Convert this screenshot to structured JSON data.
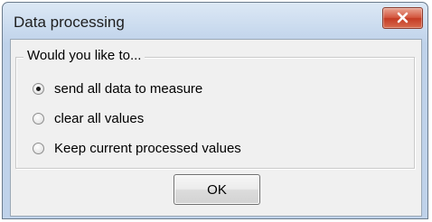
{
  "window": {
    "title": "Data processing",
    "close_icon": "close-x-icon"
  },
  "group": {
    "legend": "Would you like to..."
  },
  "options": [
    {
      "label": "send all data to measure",
      "checked": true
    },
    {
      "label": "clear all values",
      "checked": false
    },
    {
      "label": "Keep current processed values",
      "checked": false
    }
  ],
  "ok_label": "OK",
  "colors": {
    "close_button": "#c43b24",
    "titlebar": "#c9daee",
    "client_background": "#f0f0f0"
  }
}
